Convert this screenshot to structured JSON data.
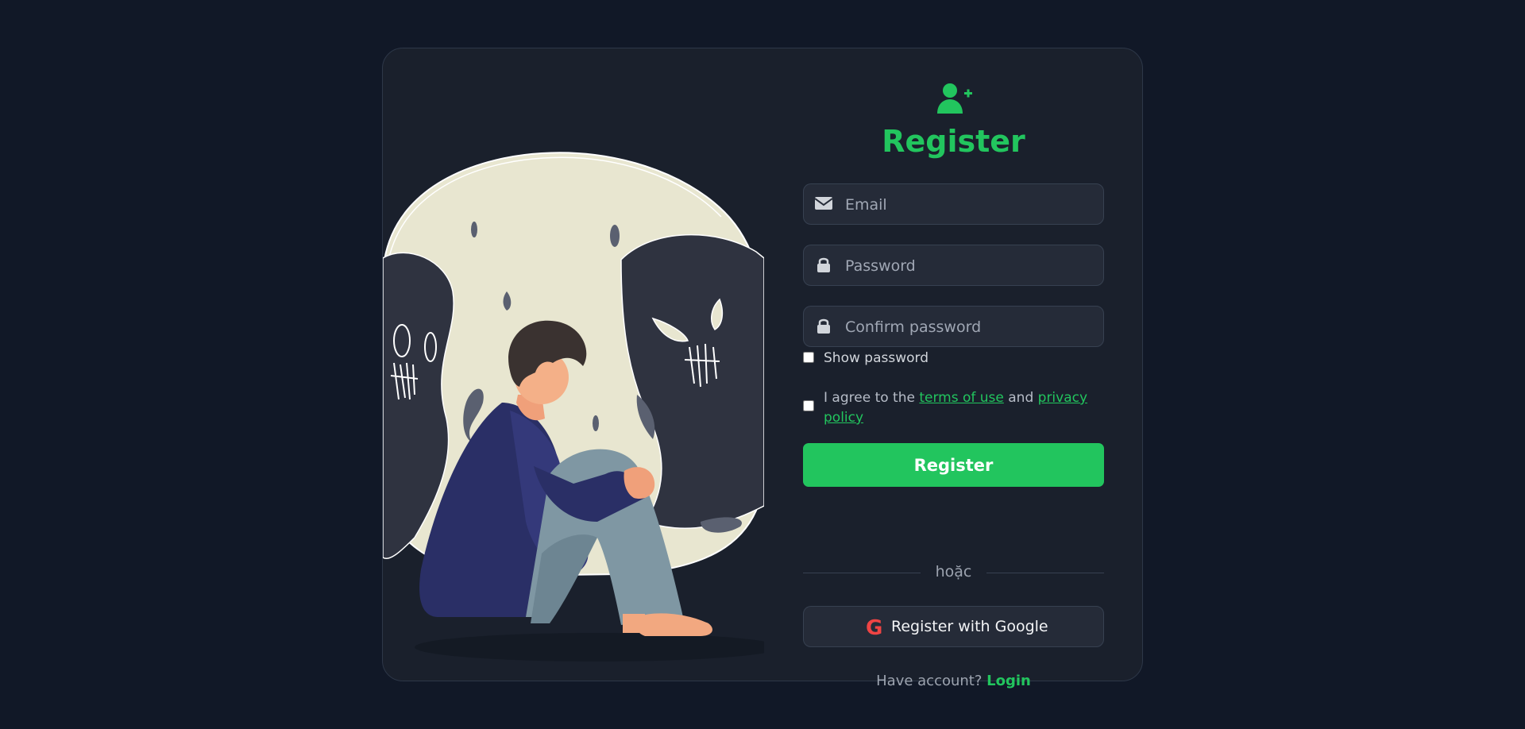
{
  "form": {
    "title": "Register",
    "email_placeholder": "Email",
    "password_placeholder": "Password",
    "confirm_placeholder": "Confirm password",
    "show_password_label": "Show password",
    "agree_prefix": "I agree to the ",
    "terms_link": "terms of use",
    "agree_and": " and ",
    "privacy_link": "privacy policy",
    "register_button": "Register",
    "divider_text": "hoặc",
    "google_button": "Register with Google",
    "have_account": "Have account?",
    "login_link": "Login"
  },
  "icons": {
    "header": "user-plus-icon",
    "email": "envelope-icon",
    "password": "lock-icon",
    "confirm": "lock-icon",
    "google": "google-icon"
  },
  "colors": {
    "accent": "#22c55e",
    "background": "#111827",
    "card": "#1a202c",
    "google": "#ef4444"
  }
}
